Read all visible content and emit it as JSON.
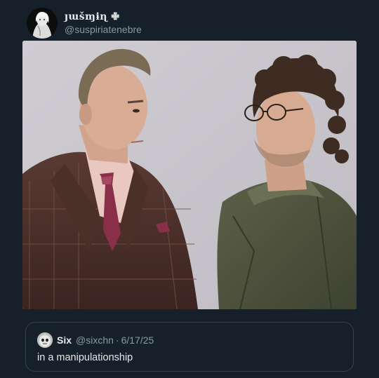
{
  "post": {
    "author": {
      "display_name": "յաšɱɨɳ ✙",
      "handle": "@suspiriatenebre",
      "avatar_icon": "user-avatar-icon"
    },
    "media": {
      "icon": "photo-image-icon"
    },
    "quoted_post": {
      "display_name": "Six",
      "handle": "@sixchn",
      "separator": "·",
      "date": "6/17/25",
      "text": "in a manipulationship",
      "avatar_icon": "user-avatar-icon"
    }
  },
  "colors": {
    "background": "#15202b",
    "border": "#38444d",
    "primary_text": "#e7e9ea",
    "secondary_text": "#8b98a5"
  }
}
